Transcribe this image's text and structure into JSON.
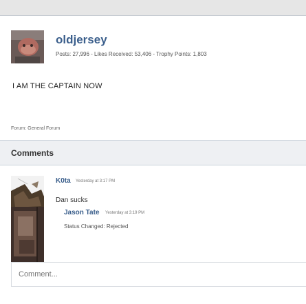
{
  "profile": {
    "username": "oldjersey",
    "stats": "Posts: 27,996 - Likes Received: 53,406 - Trophy Points: 1,803",
    "avatar_icon": "user-avatar-photo"
  },
  "post": {
    "message": "I AM THE CAPTAIN NOW",
    "forum_label": "Forum:",
    "forum_name": "General Forum"
  },
  "comments": {
    "title": "Comments",
    "items": [
      {
        "author": "K0ta",
        "time": "Yesterday at 3:17 PM",
        "body": "Dan sucks",
        "avatar_icon": "user-avatar-photo"
      },
      {
        "author": "Jason Tate",
        "time": "Yesterday at 3:19 PM",
        "body": "Status Changed: Rejected",
        "avatar_icon": "user-avatar-photo"
      }
    ],
    "input_placeholder": "Comment..."
  },
  "colors": {
    "link": "#3b5f8c",
    "header_bg": "#eef0f3",
    "border": "#cbd3dc"
  }
}
